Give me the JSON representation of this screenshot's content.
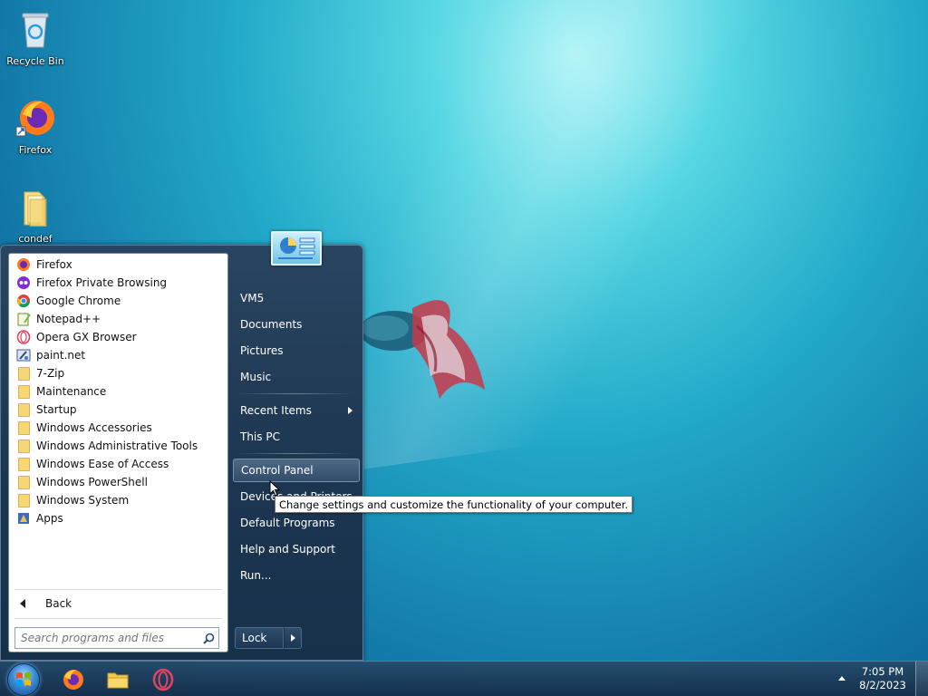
{
  "desktop": {
    "icons": [
      {
        "label": "Recycle Bin"
      },
      {
        "label": "Firefox"
      },
      {
        "label": "condef"
      }
    ]
  },
  "start_menu": {
    "programs": [
      {
        "label": "Firefox",
        "icon": "firefox-icon"
      },
      {
        "label": "Firefox Private Browsing",
        "icon": "firefox-private-icon"
      },
      {
        "label": "Google Chrome",
        "icon": "chrome-icon"
      },
      {
        "label": "Notepad++",
        "icon": "notepadpp-icon"
      },
      {
        "label": "Opera GX Browser",
        "icon": "opera-icon"
      },
      {
        "label": "paint.net",
        "icon": "paintnet-icon"
      },
      {
        "label": "7-Zip",
        "icon": "folder-icon"
      },
      {
        "label": "Maintenance",
        "icon": "folder-icon"
      },
      {
        "label": "Startup",
        "icon": "folder-icon"
      },
      {
        "label": "Windows Accessories",
        "icon": "folder-icon"
      },
      {
        "label": "Windows Administrative Tools",
        "icon": "folder-icon"
      },
      {
        "label": "Windows Ease of Access",
        "icon": "folder-icon"
      },
      {
        "label": "Windows PowerShell",
        "icon": "folder-icon"
      },
      {
        "label": "Windows System",
        "icon": "folder-icon"
      },
      {
        "label": "Apps",
        "icon": "apps-icon"
      }
    ],
    "back_label": "Back",
    "search_placeholder": "Search programs and files",
    "right_items": {
      "user": "VM5",
      "documents": "Documents",
      "pictures": "Pictures",
      "music": "Music",
      "recent_items": "Recent Items",
      "this_pc": "This PC",
      "control_panel": "Control Panel",
      "devices_printers": "Devices and Printers",
      "default_programs": "Default Programs",
      "help_support": "Help and Support",
      "run": "Run..."
    },
    "lock_label": "Lock",
    "tooltip": "Change settings and customize the functionality of your computer."
  },
  "taskbar": {
    "pinned": [
      "firefox-icon",
      "file-explorer-icon",
      "opera-icon"
    ],
    "clock_time": "7:05 PM",
    "clock_date": "8/2/2023"
  },
  "colors": {
    "start_menu_bg": "#1c3550",
    "folder": "#f5d775",
    "desktop_accent": "#23a9c9"
  }
}
